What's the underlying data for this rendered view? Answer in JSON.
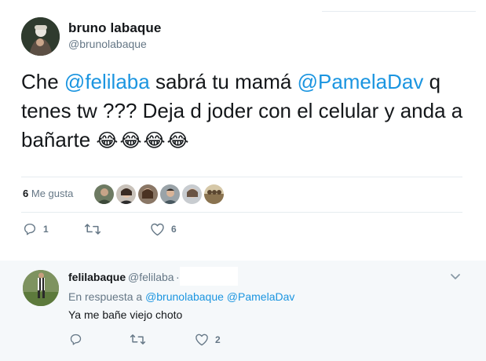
{
  "tweet": {
    "author_name": "bruno labaque",
    "author_handle": "@brunolabaque",
    "text_parts": [
      "Che ",
      "@felilaba",
      " sabrá tu mamá ",
      "@PamelaDav",
      " q tenes tw ??? Deja d joder con el celular y anda a bañarte "
    ],
    "emojis": "😂😂😂😂",
    "likes_number": "6",
    "likes_label": "Me gusta",
    "reply_count": "1",
    "retweet_count": "",
    "like_count": "6"
  },
  "reply": {
    "author_name": "felilabaque",
    "author_handle": "@felilaba",
    "separator": "·",
    "reply_to_prefix": "En respuesta a",
    "reply_to_mentions": "@brunolabaque @PamelaDav",
    "text": "Ya me bañe viejo choto",
    "reply_count": "",
    "retweet_count": "",
    "like_count": "2"
  },
  "icons": {
    "reply": "reply-icon",
    "retweet": "retweet-icon",
    "like": "heart-icon",
    "menu": "chevron-down-icon"
  },
  "colors": {
    "text": "#14171a",
    "secondary": "#657786",
    "link": "#1b95e0",
    "reply_bg": "#f5f8fa",
    "divider": "#e6ecf0"
  }
}
